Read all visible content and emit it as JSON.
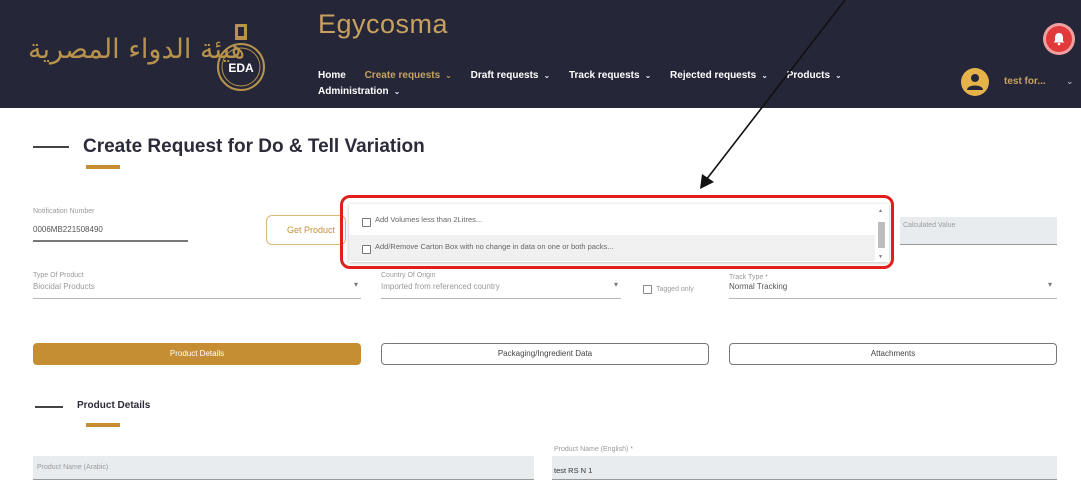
{
  "header": {
    "arabic_logo": "هيئة الدواء المصرية",
    "emblem_text": "EDA",
    "app_title": "Egycosma",
    "nav": [
      {
        "label": "Home",
        "has_dropdown": false,
        "active": false
      },
      {
        "label": "Create requests",
        "has_dropdown": true,
        "active": true
      },
      {
        "label": "Draft requests",
        "has_dropdown": true,
        "active": false
      },
      {
        "label": "Track requests",
        "has_dropdown": true,
        "active": false
      },
      {
        "label": "Rejected requests",
        "has_dropdown": true,
        "active": false
      },
      {
        "label": "Products",
        "has_dropdown": true,
        "active": false
      },
      {
        "label": "Administration",
        "has_dropdown": true,
        "active": false
      }
    ],
    "chevron": "⌄",
    "user_name": "test for...",
    "colors": {
      "background": "#252739",
      "accent": "#c8a160",
      "alert": "#e23a3a"
    }
  },
  "page": {
    "title": "Create Request for Do & Tell Variation"
  },
  "form": {
    "notification_label": "Notification Number",
    "notification_value": "0006MB221508490",
    "get_product_button": "Get Product",
    "calculated_value_placeholder": "Calculated Value",
    "type_of_product_label": "Type Of Product",
    "type_of_product_value": "Biocidal Products",
    "country_label": "Country Of Origin",
    "country_value": "Imported from referenced country",
    "mini_checkbox_label": "Tagged only",
    "track_type_label": "Track Type *",
    "track_type_value": "Normal Tracking"
  },
  "dropdown": {
    "options": [
      {
        "label": "Add Volumes less than 2Litres...",
        "checked": false
      },
      {
        "label": "Add/Remove Carton Box with no change in data on one or both packs...",
        "checked": false
      }
    ]
  },
  "tabs": [
    {
      "label": "Product Details",
      "active": true
    },
    {
      "label": "Packaging/Ingredient Data",
      "active": false
    },
    {
      "label": "Attachments",
      "active": false
    }
  ],
  "section": {
    "title": "Product Details",
    "product_name_arabic_placeholder": "Product Name (Arabic)",
    "product_name_english_label": "Product Name (English) *",
    "product_name_english_value": "test RS N 1"
  }
}
